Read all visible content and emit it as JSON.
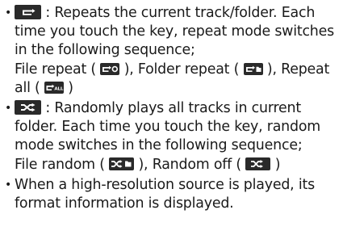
{
  "items": [
    {
      "lines": [
        {
          "after_key": " : Repeats the current track/folder. Each"
        },
        {
          "text": "time you touch the key, repeat mode switches"
        },
        {
          "text": "in the following sequence;"
        },
        {
          "seg1": "File repeat (",
          "seg2": "), Folder repeat (",
          "seg3": "), Repeat"
        },
        {
          "seg1": "all (",
          "seg2": ")"
        }
      ]
    },
    {
      "lines": [
        {
          "after_key": " : Randomly plays all tracks in current"
        },
        {
          "text": "folder. Each time you touch the key, random"
        },
        {
          "text": "mode switches in the following sequence;"
        },
        {
          "seg1": "File random (",
          "seg2": "), Random off (",
          "seg3": ")"
        }
      ]
    },
    {
      "lines": [
        {
          "text": "When a high-resolution source is played, its"
        },
        {
          "text": "format information is displayed."
        }
      ]
    }
  ],
  "bullet": "•",
  "icons": {
    "repeat_key": "repeat-icon",
    "file_repeat": "repeat-file-icon",
    "folder_repeat": "repeat-folder-icon",
    "repeat_all": "repeat-all-icon",
    "all_label": "ALL",
    "shuffle_key": "shuffle-icon",
    "file_random": "shuffle-folder-icon",
    "random_off": "shuffle-off-icon"
  },
  "colors": {
    "key_background": "#2a2a2a",
    "key_glyph": "#ffffff",
    "text": "#1a1a1a"
  }
}
